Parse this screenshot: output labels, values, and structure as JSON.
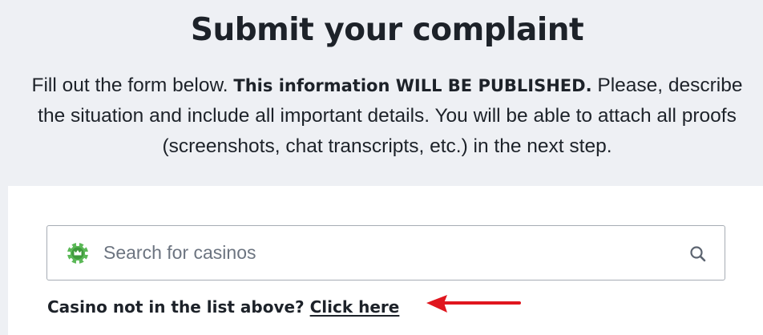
{
  "header": {
    "title": "Submit your complaint",
    "intro_lead": "Fill out the form below.",
    "intro_bold": "This information WILL BE PUBLISHED.",
    "intro_rest": "Please, describe the situation and include all important details. You will be able to attach all proofs (screenshots, chat transcripts, etc.) in the next step."
  },
  "search": {
    "placeholder": "Search for casinos",
    "value": "",
    "leading_icon": "casino-chip-icon",
    "trailing_icon": "search-icon"
  },
  "fallback": {
    "question": "Casino not in the list above?",
    "link_label": "Click here"
  },
  "annotation": {
    "icon": "red-arrow-icon",
    "color": "#e0161e"
  },
  "colors": {
    "background": "#eef0f4",
    "panel": "#ffffff",
    "chip_green": "#5bb857",
    "text": "#1d2229"
  }
}
